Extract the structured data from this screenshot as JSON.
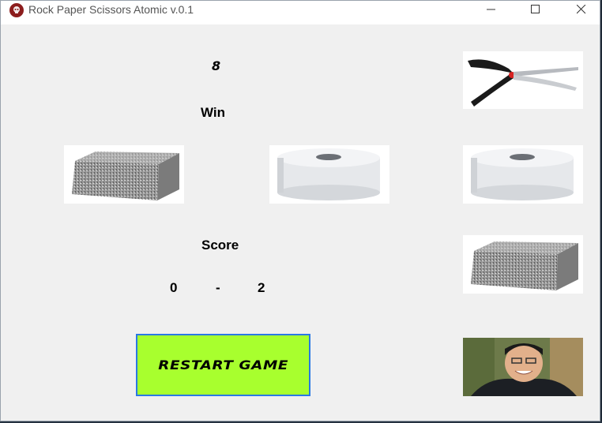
{
  "window": {
    "title": "Rock Paper Scissors Atomic v.0.1",
    "icon": "skull-icon",
    "controls": [
      "minimize-icon",
      "maximize-icon",
      "close-icon"
    ]
  },
  "game": {
    "counter": "8",
    "result_text": "Win",
    "player_choice": "rock",
    "middle_choice": "paper",
    "score_label": "Score",
    "score_left": "0",
    "score_separator": "-",
    "score_right": "2",
    "restart_label": "RESTART GAME"
  },
  "choices_panel": [
    "scissors",
    "paper",
    "rock",
    "opponent-portrait"
  ],
  "colors": {
    "restart_bg": "#a8ff2e",
    "restart_border": "#2a78e4",
    "window_bg": "#f0f0f0"
  }
}
